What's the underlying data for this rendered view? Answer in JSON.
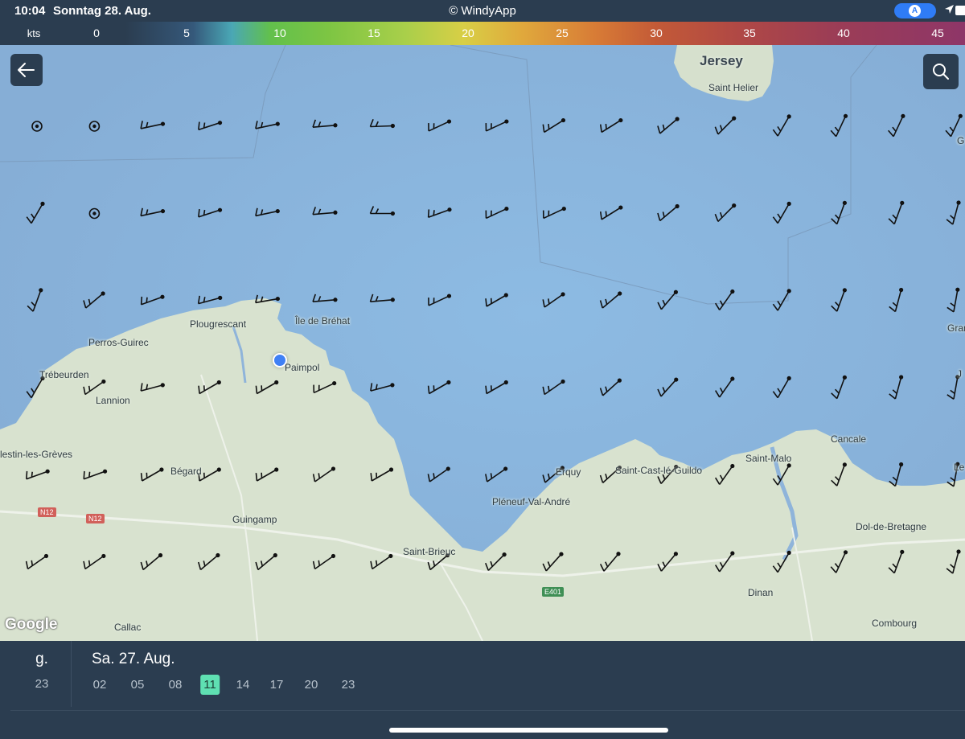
{
  "status_bar": {
    "time": "10:04",
    "date": "Sonntag 28. Aug.",
    "title": "© WindyApp",
    "pill_letter": "A"
  },
  "wind_scale": {
    "unit": "kts",
    "labels": [
      "0",
      "5",
      "10",
      "15",
      "20",
      "25",
      "30",
      "35",
      "40",
      "45"
    ]
  },
  "map": {
    "places": {
      "jersey": "Jersey",
      "saint_helier": "Saint Helier",
      "ile_de_brehat": "Île de Bréhat",
      "plougrescant": "Plougrescant",
      "perros_guirec": "Perros-Guirec",
      "paimpol": "Paimpol",
      "trebeurden": "Trébeurden",
      "lannion": "Lannion",
      "destin_les_greves": "lestin-les-Grèves",
      "begard": "Bégard",
      "guingamp": "Guingamp",
      "saint_brieuc": "Saint-Brieuc",
      "erquy": "Erquy",
      "saint_cast": "Saint-Cast-lé-Guildo",
      "pleneuf": "Pléneuf-Val-André",
      "saint_malo": "Saint-Malo",
      "cancale": "Cancale",
      "dol_de_bretagne": "Dol-de-Bretagne",
      "dinan": "Dinan",
      "combourg": "Combourg",
      "callac": "Callac",
      "gran": "Gran",
      "g_edge": "G",
      "j_edge": "J",
      "le_edge": "Le"
    },
    "roads": {
      "n12_a": "N12",
      "n12_b": "N12",
      "e401": "E401"
    },
    "attribution": "Google",
    "back_icon": "arrow-left-icon",
    "search_icon": "search-icon",
    "wind_barbs": {
      "columns": 17,
      "rows": 6,
      "directions_deg": [
        [
          -1,
          -1,
          258,
          252,
          258,
          265,
          268,
          245,
          245,
          238,
          238,
          230,
          225,
          210,
          205,
          205,
          205
        ],
        [
          210,
          -1,
          258,
          252,
          258,
          265,
          270,
          250,
          245,
          245,
          238,
          230,
          225,
          210,
          200,
          200,
          195
        ],
        [
          200,
          230,
          250,
          255,
          260,
          265,
          265,
          245,
          240,
          235,
          230,
          220,
          215,
          210,
          200,
          195,
          190
        ],
        [
          210,
          235,
          255,
          240,
          240,
          245,
          255,
          240,
          240,
          235,
          228,
          222,
          215,
          210,
          200,
          195,
          190
        ],
        [
          250,
          250,
          240,
          240,
          240,
          235,
          240,
          235,
          235,
          230,
          228,
          222,
          215,
          210,
          200,
          195,
          190
        ],
        [
          235,
          235,
          230,
          230,
          230,
          235,
          235,
          230,
          225,
          222,
          220,
          220,
          215,
          210,
          205,
          200,
          195
        ]
      ]
    }
  },
  "timeline": {
    "prev_day": "g.",
    "prev_hour": "23",
    "day": "Sa. 27. Aug.",
    "hours": [
      "02",
      "05",
      "08",
      "11",
      "14",
      "17",
      "20",
      "23"
    ],
    "active_hour": "11"
  },
  "colors": {
    "chrome": "#2b3d50",
    "active_hour": "#5fe0b2",
    "sea": "#8fb4da",
    "land": "#d8e2cf",
    "location": "#3f80f5"
  }
}
